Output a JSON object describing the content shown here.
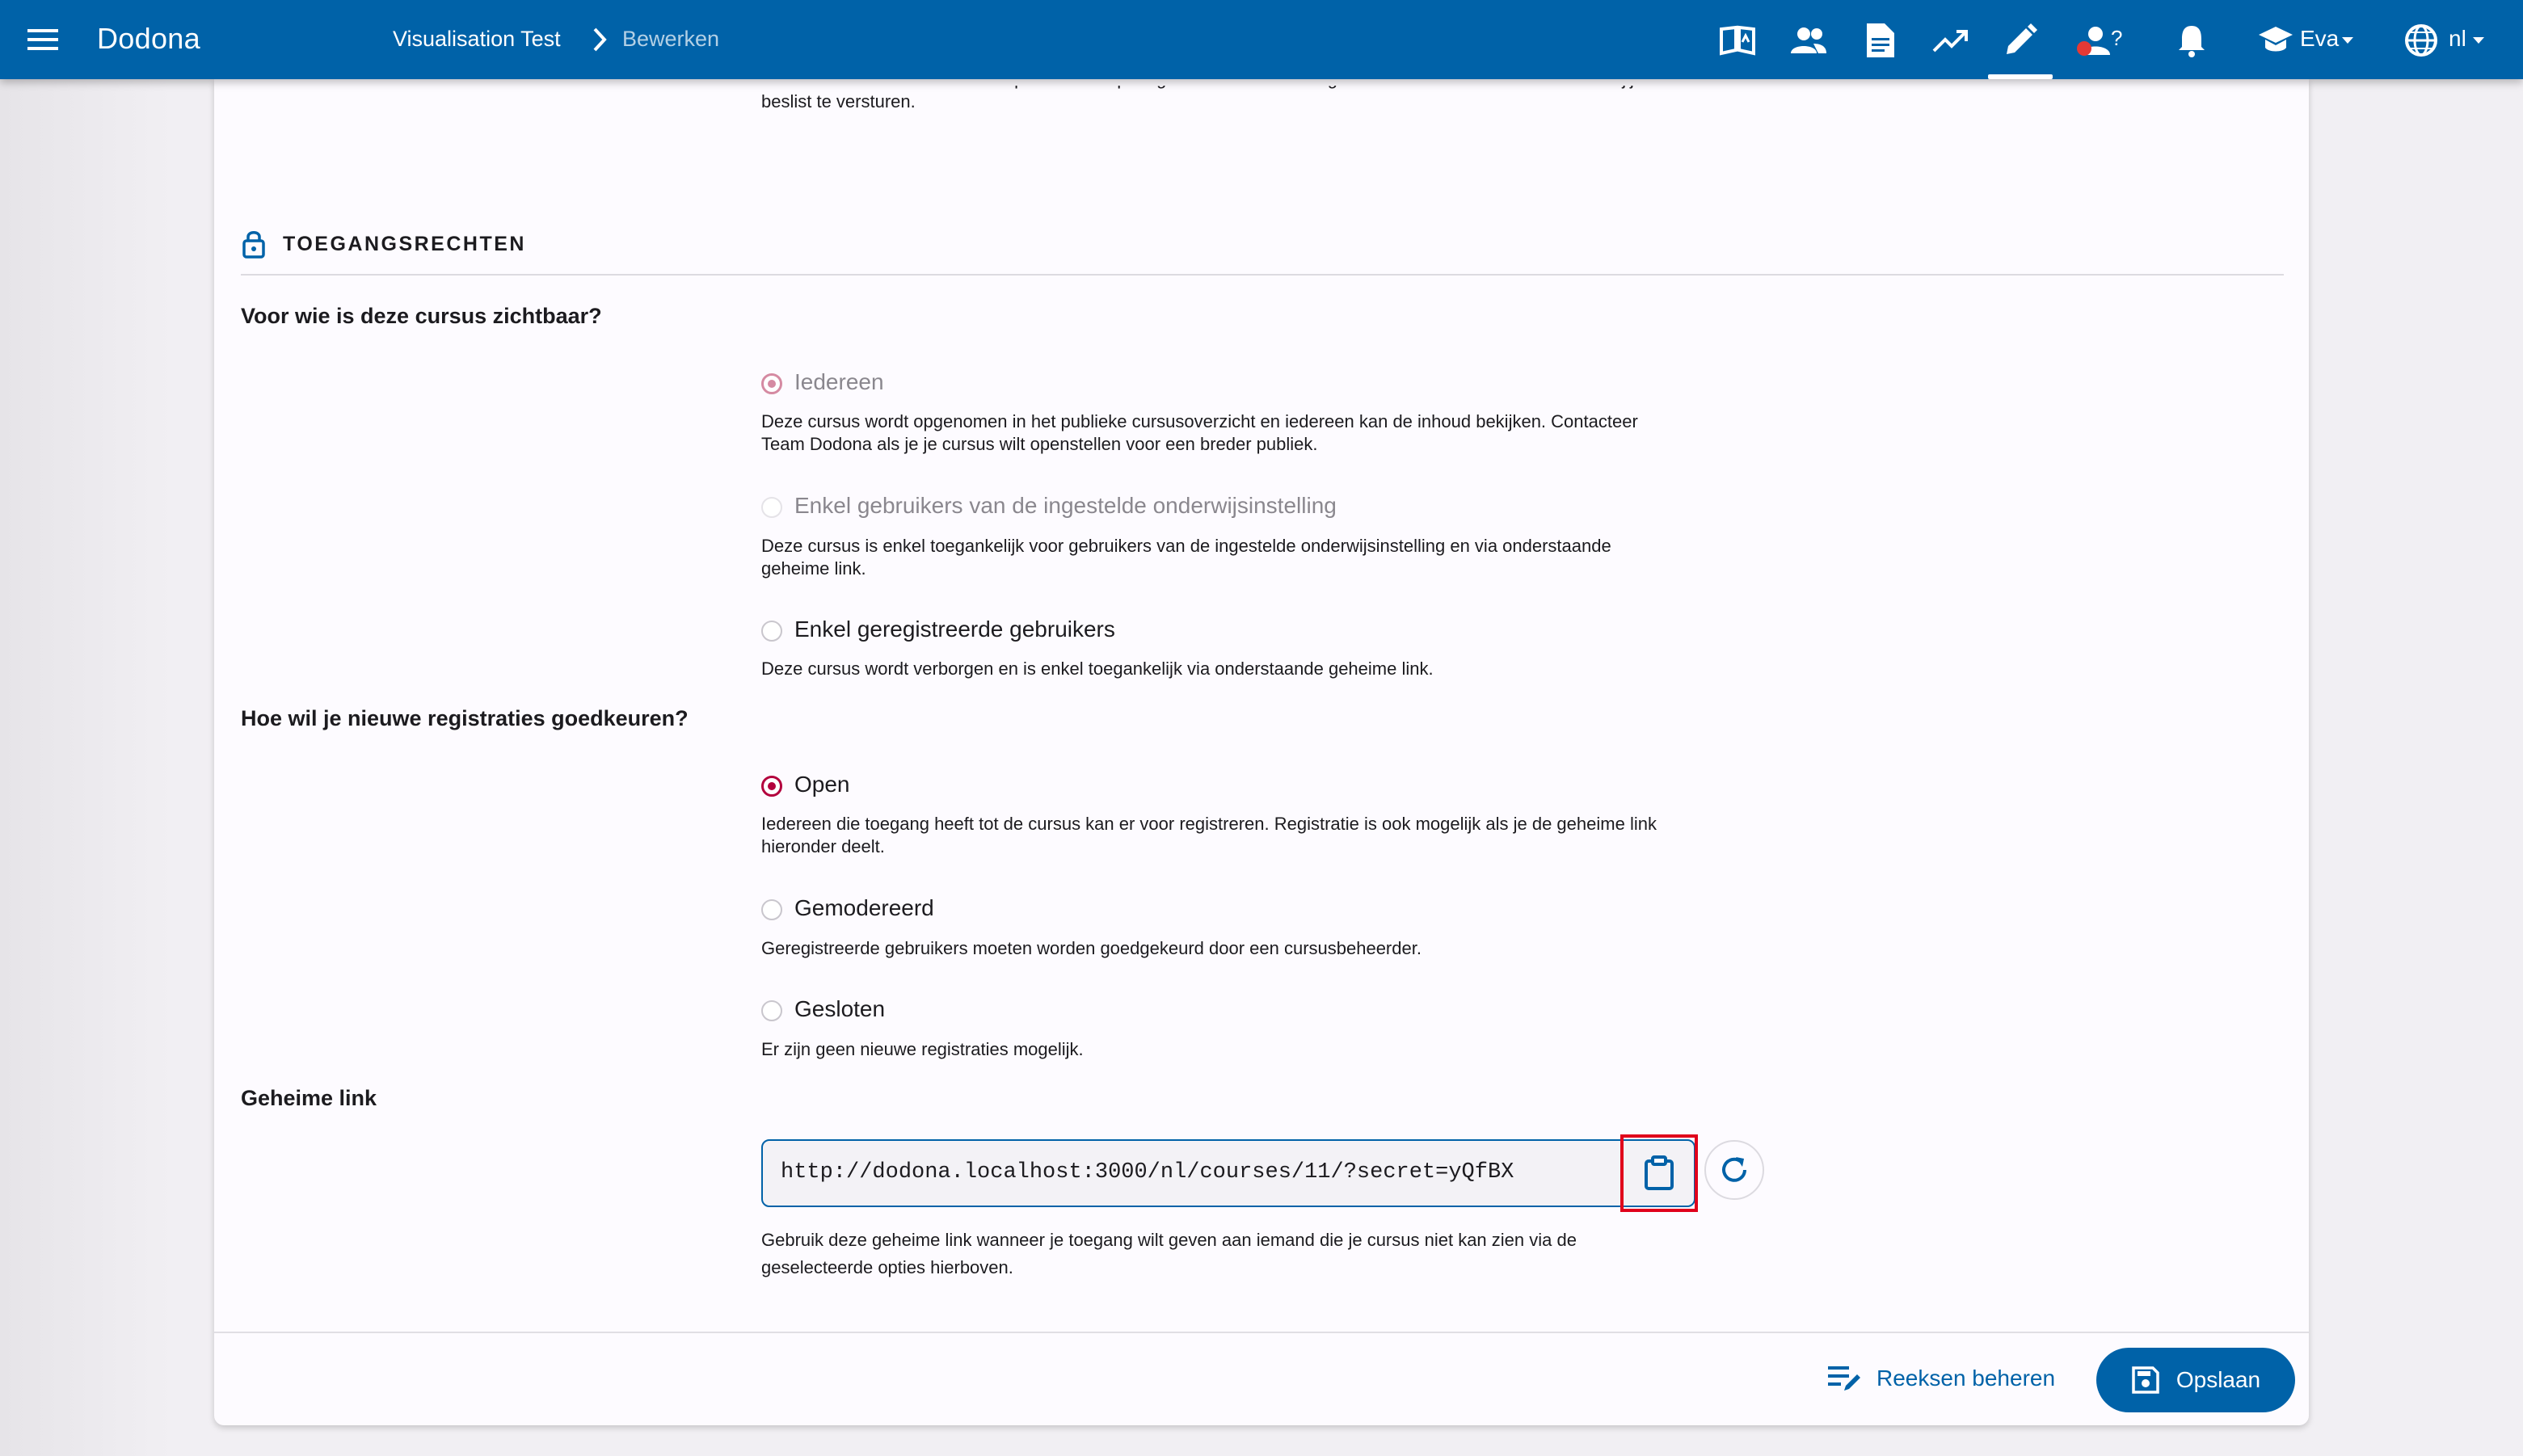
{
  "app": {
    "brand": "Dodona"
  },
  "breadcrumb": {
    "course": "Visualisation Test",
    "current": "Bewerken"
  },
  "topbar": {
    "user_label": "Eva",
    "language_label": "nl",
    "help_mark": "?",
    "icons": [
      "book-icon",
      "users-icon",
      "document-icon",
      "trending-up-icon",
      "pencil-icon",
      "user-help-icon",
      "bell-icon",
      "school-icon",
      "globe-icon"
    ]
  },
  "top_fragment": {
    "line1": "Gebruik een LLM om een conceptantwoord op vragen van studenten te genereren. Studenten zien enkel wat jij",
    "line2": "beslist te versturen."
  },
  "access_section": {
    "title": "TOEGANGSRECHTEN",
    "visibility_question": "Voor wie is deze cursus zichtbaar?",
    "visibility_options": [
      {
        "label": "Iedereen",
        "desc1": "Deze cursus wordt opgenomen in het publieke cursusoverzicht en iedereen kan de inhoud bekijken. Contacteer",
        "desc2": "Team Dodona als je je cursus wilt openstellen voor een breder publiek.",
        "selected": true
      },
      {
        "label": "Enkel gebruikers van de ingestelde onderwijsinstelling",
        "desc1": "Deze cursus is enkel toegankelijk voor gebruikers van de ingestelde onderwijsinstelling en via onderstaande",
        "desc2": "geheime link.",
        "selected": false
      },
      {
        "label": "Enkel geregistreerde gebruikers",
        "desc1": "Deze cursus wordt verborgen en is enkel toegankelijk via onderstaande geheime link.",
        "selected": false
      }
    ],
    "registration_question": "Hoe wil je nieuwe registraties goedkeuren?",
    "registration_options": [
      {
        "label": "Open",
        "desc1": "Iedereen die toegang heeft tot de cursus kan er voor registreren. Registratie is ook mogelijk als je de geheime link",
        "desc2": "hieronder deelt.",
        "selected": true
      },
      {
        "label": "Gemodereerd",
        "desc1": "Geregistreerde gebruikers moeten worden goedgekeurd door een cursusbeheerder.",
        "selected": false
      },
      {
        "label": "Gesloten",
        "desc1": "Er zijn geen nieuwe registraties mogelijk.",
        "selected": false
      }
    ],
    "secret_link_label": "Geheime link",
    "secret_link_value": "http://dodona.localhost:3000/nl/courses/11/?secret=yQfBX",
    "secret_link_help1": "Gebruik deze geheime link wanneer je toegang wilt geven aan iemand die je cursus niet kan zien via de",
    "secret_link_help2": "geselecteerde opties hierboven."
  },
  "footer": {
    "manage_label": "Reeksen beheren",
    "save_label": "Opslaan"
  },
  "colors": {
    "primary": "#0062a8",
    "radio_selected": "#b3003d",
    "highlight": "#e0001b"
  }
}
